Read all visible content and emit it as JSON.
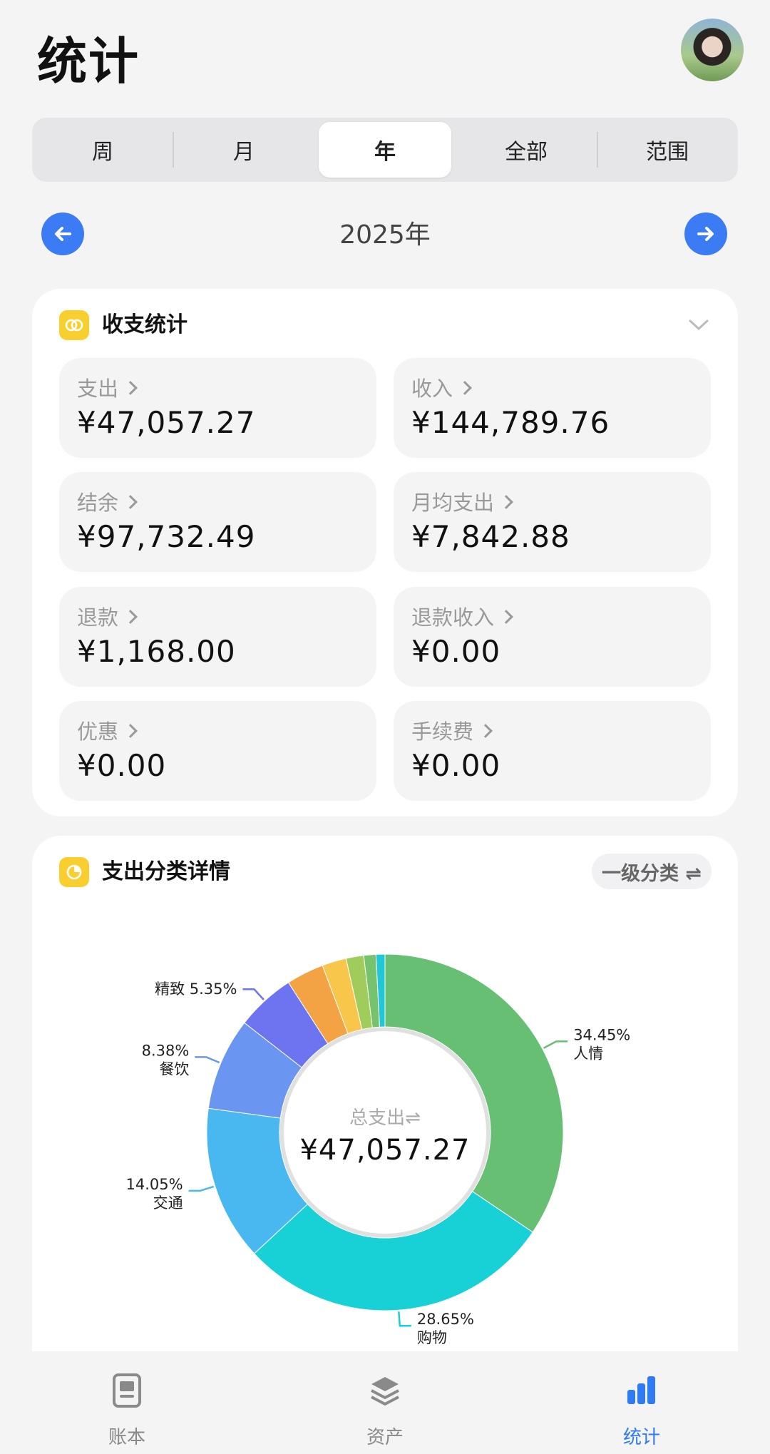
{
  "header": {
    "title": "统计"
  },
  "period_tabs": [
    "周",
    "月",
    "年",
    "全部",
    "范围"
  ],
  "active_tab_index": 2,
  "current_period": "2025年",
  "summary_card": {
    "title": "收支统计",
    "stats": [
      {
        "label": "支出",
        "value": "¥47,057.27"
      },
      {
        "label": "收入",
        "value": "¥144,789.76"
      },
      {
        "label": "结余",
        "value": "¥97,732.49"
      },
      {
        "label": "月均支出",
        "value": "¥7,842.88"
      },
      {
        "label": "退款",
        "value": "¥1,168.00"
      },
      {
        "label": "退款收入",
        "value": "¥0.00"
      },
      {
        "label": "优惠",
        "value": "¥0.00"
      },
      {
        "label": "手续费",
        "value": "¥0.00"
      }
    ]
  },
  "category_card": {
    "title": "支出分类详情",
    "level_toggle": "一级分类 ⇌",
    "center_label": "总支出⇌",
    "center_value": "¥47,057.27"
  },
  "chart_data": {
    "type": "pie",
    "variant": "donut",
    "slices": [
      {
        "name": "人情",
        "value": 34.45,
        "label": "34.45%",
        "color": "#66bf73"
      },
      {
        "name": "购物",
        "value": 28.65,
        "label": "28.65%",
        "color": "#18d1d6"
      },
      {
        "name": "交通",
        "value": 14.05,
        "label": "14.05%",
        "color": "#49b8f0"
      },
      {
        "name": "餐饮",
        "value": 8.38,
        "label": "8.38%",
        "color": "#6a95f0"
      },
      {
        "name": "精致",
        "value": 5.35,
        "label": "5.35%",
        "color": "#6d74ef"
      },
      {
        "name": "",
        "value": 3.4,
        "label": "",
        "color": "#f3a244"
      },
      {
        "name": "",
        "value": 2.2,
        "label": "",
        "color": "#f7c64a"
      },
      {
        "name": "",
        "value": 1.6,
        "label": "",
        "color": "#9fcc5a"
      },
      {
        "name": "",
        "value": 1.1,
        "label": "",
        "color": "#76c26d"
      },
      {
        "name": "",
        "value": 0.81,
        "label": "",
        "color": "#22c7d6"
      }
    ]
  },
  "tabbar": [
    {
      "label": "账本",
      "icon": "book-icon"
    },
    {
      "label": "资产",
      "icon": "layers-icon"
    },
    {
      "label": "统计",
      "icon": "bar-chart-icon"
    }
  ],
  "colors": {
    "accent": "#3b7bf4",
    "tab_active": "#2f7bf4",
    "card_icon": "#f9cf2f"
  }
}
